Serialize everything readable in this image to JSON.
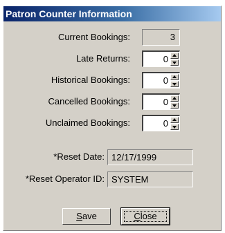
{
  "window": {
    "title": "Patron Counter Information"
  },
  "counters": [
    {
      "label": "Current Bookings:",
      "value": "3",
      "editable": false
    },
    {
      "label": "Late Returns:",
      "value": "0",
      "editable": true
    },
    {
      "label": "Historical Bookings:",
      "value": "0",
      "editable": true
    },
    {
      "label": "Cancelled Bookings:",
      "value": "0",
      "editable": true
    },
    {
      "label": "Unclaimed Bookings:",
      "value": "0",
      "editable": true
    }
  ],
  "reset": {
    "date_label": "*Reset Date:",
    "date_value": "12/17/1999",
    "operator_label": "*Reset Operator ID:",
    "operator_value": "SYSTEM"
  },
  "buttons": {
    "save_label": "Save",
    "close_label": "Close"
  },
  "colors": {
    "title_bar_start": "#0a246a",
    "title_bar_end": "#a6caf0",
    "dialog_face": "#d4d0c8"
  }
}
